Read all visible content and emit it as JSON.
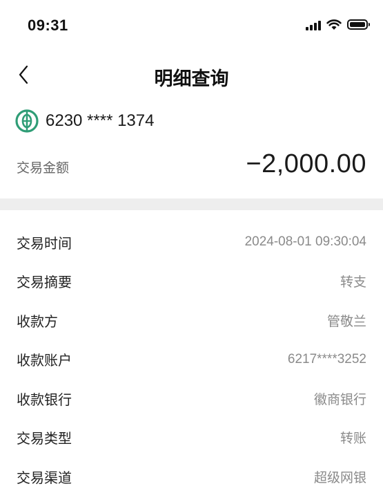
{
  "status_bar": {
    "time": "09:31"
  },
  "header": {
    "title": "明细查询"
  },
  "account": {
    "number": "6230 **** 1374"
  },
  "amount": {
    "label": "交易金额",
    "value": "−2,000.00"
  },
  "details": [
    {
      "label": "交易时间",
      "value": "2024-08-01 09:30:04"
    },
    {
      "label": "交易摘要",
      "value": "转支"
    },
    {
      "label": "收款方",
      "value": "管敬兰"
    },
    {
      "label": "收款账户",
      "value": "6217****3252"
    },
    {
      "label": "收款银行",
      "value": "徽商银行"
    },
    {
      "label": "交易类型",
      "value": "转账"
    },
    {
      "label": "交易渠道",
      "value": "超级网银"
    }
  ],
  "colors": {
    "bank_logo": "#2f9d76",
    "divider": "#eeeeee",
    "value_text": "#8a8a8a"
  },
  "icons": {
    "back": "chevron-left-icon",
    "logo": "bank-logo-icon",
    "signal": "signal-icon",
    "wifi": "wifi-icon",
    "battery": "battery-icon"
  }
}
